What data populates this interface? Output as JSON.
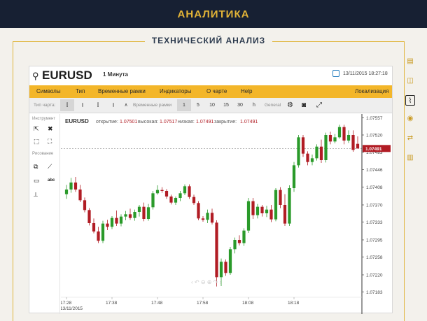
{
  "banner": {
    "title": "АНАЛИТИКА"
  },
  "section": {
    "title": "ТЕХНИЧЕСКИЙ АНАЛИЗ"
  },
  "header": {
    "symbol": "EURUSD",
    "interval": "1 Минута",
    "datetime": "13/11/2015 18:27:18"
  },
  "menu": {
    "items": [
      "Символы",
      "Тип",
      "Временные рамки",
      "Индикаторы",
      "О чарте",
      "Help"
    ],
    "localization": "Локализация"
  },
  "toolbar": {
    "chart_type_label": "Тип чарта:",
    "timeframe_label": "Временные рамки",
    "timeframes": [
      "1",
      "5",
      "10",
      "15",
      "30",
      "h"
    ],
    "active_timeframe": "1",
    "general_label": "General"
  },
  "sidebar": {
    "tools_label": "Инструмент",
    "drawing_label": "Рисование",
    "text_tool": "abc"
  },
  "legend": {
    "symbol": "EURUSD",
    "open_label": "открытие:",
    "open": "1.07501",
    "high_label": "высокая:",
    "high": "1.07517",
    "low_label": "низкая:",
    "low": "1.07491",
    "close_label": "закрытие:",
    "close": "1.07491"
  },
  "colors": {
    "up": "#2a9a2a",
    "down": "#b11c24",
    "accent": "#f3b62a",
    "banner_bg": "#172033",
    "banner_text": "#e3b437"
  },
  "chart_data": {
    "type": "candlestick",
    "title": "EURUSD",
    "xlabel": "",
    "ylabel": "",
    "x_ticks": [
      "17:28",
      "17:38",
      "17:48",
      "17:58",
      "18:08",
      "18:18"
    ],
    "x_date": "13/11/2015",
    "y_ticks": [
      1.07557,
      1.0752,
      1.07483,
      1.07446,
      1.07408,
      1.0737,
      1.07333,
      1.07295,
      1.07258,
      1.0722,
      1.07183
    ],
    "ylim": [
      1.07172,
      1.07562
    ],
    "current_price": "1.07491",
    "current_price_value": 1.07491,
    "candles": [
      {
        "o": 1.07393,
        "h": 1.07413,
        "l": 1.07383,
        "c": 1.07403
      },
      {
        "o": 1.07403,
        "h": 1.07428,
        "l": 1.07396,
        "c": 1.07418
      },
      {
        "o": 1.07418,
        "h": 1.0743,
        "l": 1.07398,
        "c": 1.07403
      },
      {
        "o": 1.07403,
        "h": 1.07413,
        "l": 1.07376,
        "c": 1.0738
      },
      {
        "o": 1.0738,
        "h": 1.07386,
        "l": 1.07354,
        "c": 1.07359
      },
      {
        "o": 1.07359,
        "h": 1.07363,
        "l": 1.07326,
        "c": 1.07331
      },
      {
        "o": 1.07331,
        "h": 1.07341,
        "l": 1.07309,
        "c": 1.07313
      },
      {
        "o": 1.07313,
        "h": 1.07323,
        "l": 1.07288,
        "c": 1.07293
      },
      {
        "o": 1.07293,
        "h": 1.07336,
        "l": 1.07288,
        "c": 1.0733
      },
      {
        "o": 1.0733,
        "h": 1.07338,
        "l": 1.07316,
        "c": 1.07323
      },
      {
        "o": 1.07323,
        "h": 1.07346,
        "l": 1.07318,
        "c": 1.07342
      },
      {
        "o": 1.07342,
        "h": 1.07358,
        "l": 1.07325,
        "c": 1.0733
      },
      {
        "o": 1.0733,
        "h": 1.0735,
        "l": 1.07324,
        "c": 1.07345
      },
      {
        "o": 1.07345,
        "h": 1.07357,
        "l": 1.07337,
        "c": 1.0735
      },
      {
        "o": 1.0735,
        "h": 1.07362,
        "l": 1.07338,
        "c": 1.07342
      },
      {
        "o": 1.07342,
        "h": 1.0736,
        "l": 1.07336,
        "c": 1.07355
      },
      {
        "o": 1.07355,
        "h": 1.0737,
        "l": 1.07345,
        "c": 1.07366
      },
      {
        "o": 1.07366,
        "h": 1.07375,
        "l": 1.07335,
        "c": 1.0734
      },
      {
        "o": 1.0734,
        "h": 1.07372,
        "l": 1.07336,
        "c": 1.07365
      },
      {
        "o": 1.07365,
        "h": 1.074,
        "l": 1.0736,
        "c": 1.07395
      },
      {
        "o": 1.07395,
        "h": 1.07412,
        "l": 1.07392,
        "c": 1.07402
      },
      {
        "o": 1.07402,
        "h": 1.07408,
        "l": 1.07396,
        "c": 1.074
      },
      {
        "o": 1.074,
        "h": 1.07404,
        "l": 1.07383,
        "c": 1.07388
      },
      {
        "o": 1.07388,
        "h": 1.07392,
        "l": 1.07371,
        "c": 1.07375
      },
      {
        "o": 1.07375,
        "h": 1.07388,
        "l": 1.0737,
        "c": 1.07385
      },
      {
        "o": 1.07385,
        "h": 1.074,
        "l": 1.07378,
        "c": 1.07395
      },
      {
        "o": 1.07395,
        "h": 1.07414,
        "l": 1.07391,
        "c": 1.0741
      },
      {
        "o": 1.0741,
        "h": 1.07414,
        "l": 1.07383,
        "c": 1.07387
      },
      {
        "o": 1.07387,
        "h": 1.07392,
        "l": 1.0737,
        "c": 1.07374
      },
      {
        "o": 1.07374,
        "h": 1.07378,
        "l": 1.07337,
        "c": 1.07341
      },
      {
        "o": 1.07341,
        "h": 1.07346,
        "l": 1.07334,
        "c": 1.07338
      },
      {
        "o": 1.07338,
        "h": 1.0736,
        "l": 1.07331,
        "c": 1.07353
      },
      {
        "o": 1.07353,
        "h": 1.07362,
        "l": 1.07328,
        "c": 1.07332
      },
      {
        "o": 1.07332,
        "h": 1.07337,
        "l": 1.07195,
        "c": 1.07215
      },
      {
        "o": 1.07215,
        "h": 1.07255,
        "l": 1.07196,
        "c": 1.07248
      },
      {
        "o": 1.07248,
        "h": 1.07253,
        "l": 1.07218,
        "c": 1.07224
      },
      {
        "o": 1.07224,
        "h": 1.0728,
        "l": 1.0722,
        "c": 1.07275
      },
      {
        "o": 1.07275,
        "h": 1.073,
        "l": 1.07266,
        "c": 1.07295
      },
      {
        "o": 1.07295,
        "h": 1.07305,
        "l": 1.07283,
        "c": 1.07288
      },
      {
        "o": 1.07288,
        "h": 1.0732,
        "l": 1.07282,
        "c": 1.07315
      },
      {
        "o": 1.07315,
        "h": 1.07385,
        "l": 1.0731,
        "c": 1.07378
      },
      {
        "o": 1.07378,
        "h": 1.07385,
        "l": 1.0734,
        "c": 1.07348
      },
      {
        "o": 1.07348,
        "h": 1.07372,
        "l": 1.07341,
        "c": 1.07366
      },
      {
        "o": 1.07366,
        "h": 1.0737,
        "l": 1.07345,
        "c": 1.07352
      },
      {
        "o": 1.07352,
        "h": 1.07368,
        "l": 1.07344,
        "c": 1.0736
      },
      {
        "o": 1.0736,
        "h": 1.0737,
        "l": 1.07333,
        "c": 1.07339
      },
      {
        "o": 1.07339,
        "h": 1.07406,
        "l": 1.07335,
        "c": 1.07402
      },
      {
        "o": 1.07402,
        "h": 1.07408,
        "l": 1.07363,
        "c": 1.0737
      },
      {
        "o": 1.0737,
        "h": 1.07393,
        "l": 1.07325,
        "c": 1.0733
      },
      {
        "o": 1.0733,
        "h": 1.07412,
        "l": 1.07325,
        "c": 1.07406
      },
      {
        "o": 1.07406,
        "h": 1.07462,
        "l": 1.07398,
        "c": 1.07455
      },
      {
        "o": 1.07455,
        "h": 1.0752,
        "l": 1.0745,
        "c": 1.07515
      },
      {
        "o": 1.07515,
        "h": 1.0752,
        "l": 1.07473,
        "c": 1.0748
      },
      {
        "o": 1.0748,
        "h": 1.07485,
        "l": 1.07455,
        "c": 1.07462
      },
      {
        "o": 1.07462,
        "h": 1.07478,
        "l": 1.07455,
        "c": 1.0747
      },
      {
        "o": 1.0747,
        "h": 1.075,
        "l": 1.07465,
        "c": 1.07495
      },
      {
        "o": 1.07495,
        "h": 1.0751,
        "l": 1.0746,
        "c": 1.07466
      },
      {
        "o": 1.07466,
        "h": 1.07525,
        "l": 1.07461,
        "c": 1.0752
      },
      {
        "o": 1.0752,
        "h": 1.07527,
        "l": 1.075,
        "c": 1.07506
      },
      {
        "o": 1.07506,
        "h": 1.07522,
        "l": 1.07502,
        "c": 1.07515
      },
      {
        "o": 1.07515,
        "h": 1.07542,
        "l": 1.07512,
        "c": 1.07537
      },
      {
        "o": 1.07537,
        "h": 1.07542,
        "l": 1.075,
        "c": 1.07508
      },
      {
        "o": 1.07508,
        "h": 1.0753,
        "l": 1.07503,
        "c": 1.0752
      },
      {
        "o": 1.0752,
        "h": 1.0753,
        "l": 1.07484,
        "c": 1.07488
      },
      {
        "o": 1.07501,
        "h": 1.07517,
        "l": 1.07491,
        "c": 1.07491
      }
    ]
  }
}
